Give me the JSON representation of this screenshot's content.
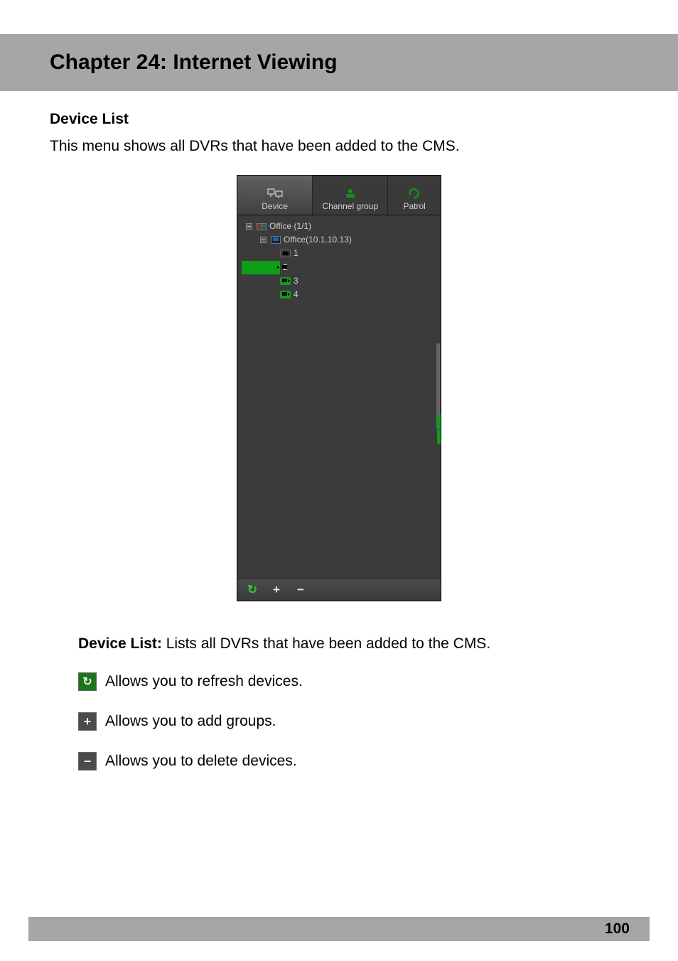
{
  "chapter": {
    "title": "Chapter 24: Internet Viewing"
  },
  "section": {
    "title": "Device List",
    "intro": "This menu shows all DVRs that have been added to the CMS."
  },
  "screenshot": {
    "tabs": {
      "device": {
        "label": "Device",
        "active": true
      },
      "group": {
        "label": "Channel group",
        "active": false
      },
      "patrol": {
        "label": "Patrol",
        "active": false
      }
    },
    "tree": {
      "site": {
        "label": "Office (1/1)"
      },
      "dvr": {
        "label": "Office(10.1.10.13)"
      },
      "channels": [
        {
          "num": "1",
          "active": false,
          "selected": false
        },
        {
          "num": "2",
          "active": true,
          "selected": true
        },
        {
          "num": "3",
          "active": true,
          "selected": false
        },
        {
          "num": "4",
          "active": true,
          "selected": false
        }
      ]
    },
    "toolbar": {
      "refresh": "↻",
      "add": "+",
      "remove": "−"
    }
  },
  "descriptions": {
    "device_list": {
      "label": "Device List:",
      "text": " Lists all DVRs that have been added to the CMS."
    },
    "refresh": "Allows you to refresh devices.",
    "add": "Allows you to add groups.",
    "delete": "Allows you to delete devices."
  },
  "page_number": "100"
}
